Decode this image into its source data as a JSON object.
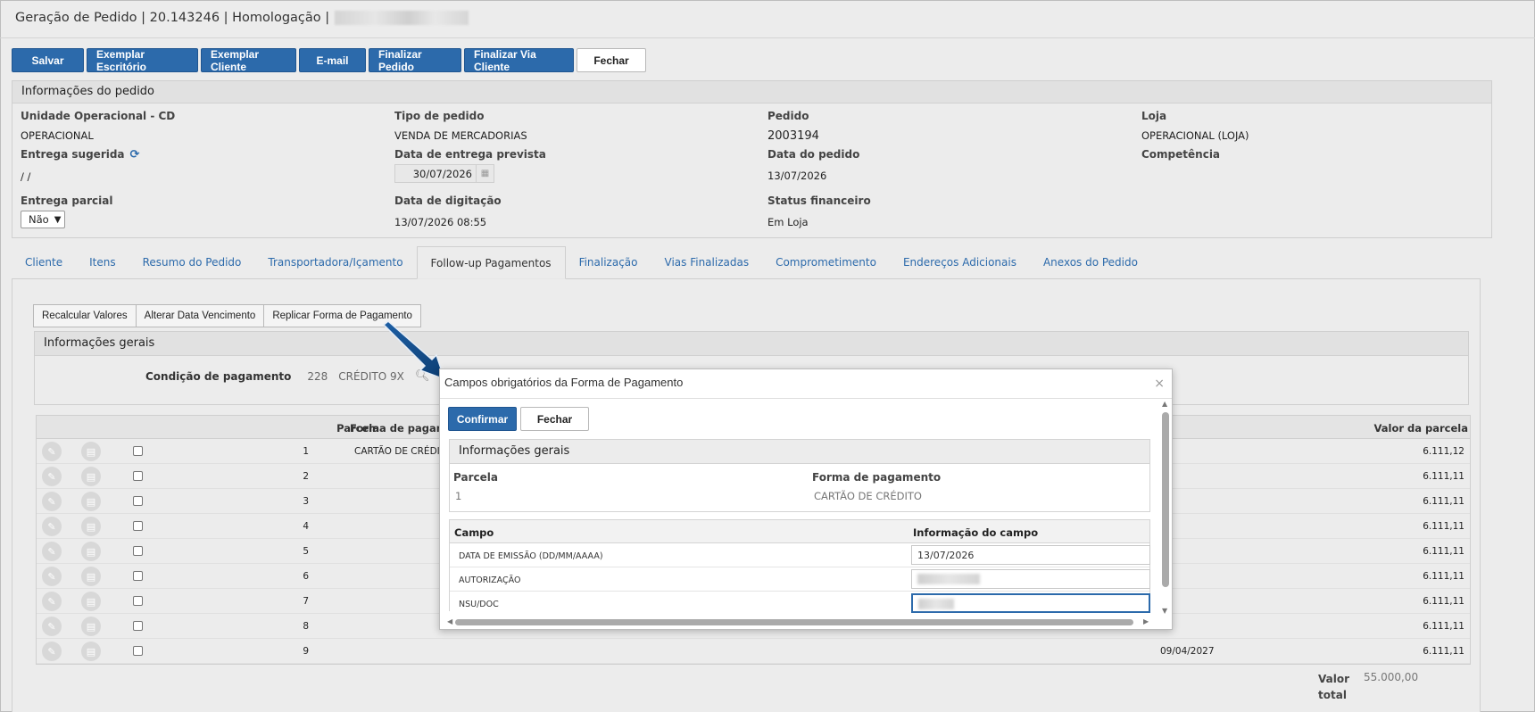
{
  "window": {
    "title": "Geração de Pedido | 20.143246 | Homologação |"
  },
  "toolbar": {
    "buttons": [
      "Salvar",
      "Exemplar Escritório",
      "Exemplar Cliente",
      "E-mail",
      "Finalizar Pedido",
      "Finalizar Via Cliente",
      "Fechar"
    ]
  },
  "order_info": {
    "heading": "Informações do pedido",
    "unidade_label": "Unidade Operacional - CD",
    "unidade_value": "OPERACIONAL",
    "tipo_label": "Tipo de pedido",
    "tipo_value": "VENDA DE MERCADORIAS",
    "pedido_label": "Pedido",
    "pedido_value": "2003194",
    "loja_label": "Loja",
    "loja_value": "OPERACIONAL (LOJA)",
    "entrega_sug_label": "Entrega sugerida",
    "entrega_sug_value": "/ /",
    "entrega_prev_label": "Data de entrega prevista",
    "entrega_prev_value": "30/07/2026",
    "data_pedido_label": "Data do pedido",
    "data_pedido_value": "13/07/2026",
    "competencia_label": "Competência",
    "entrega_parcial_label": "Entrega parcial",
    "entrega_parcial_value": "Não",
    "digitacao_label": "Data de digitação",
    "digitacao_value": "13/07/2026 08:55",
    "status_label": "Status financeiro",
    "status_value": "Em Loja"
  },
  "tabs": [
    "Cliente",
    "Itens",
    "Resumo do Pedido",
    "Transportadora/Içamento",
    "Follow-up Pagamentos",
    "Finalização",
    "Vias Finalizadas",
    "Comprometimento",
    "Endereços Adicionais",
    "Anexos do Pedido"
  ],
  "active_tab": "Follow-up Pagamentos",
  "sub_actions": [
    "Recalcular Valores",
    "Alterar Data Vencimento",
    "Replicar Forma de Pagamento"
  ],
  "general": {
    "heading": "Informações gerais",
    "condicao_label": "Condição de pagamento",
    "condicao_code": "228",
    "condicao_desc": "CRÉDITO 9X"
  },
  "installments": {
    "headers": {
      "parcela": "Parcela",
      "forma": "Forma de pagame",
      "valor": "Valor da parcela"
    },
    "rows": [
      {
        "n": "1",
        "forma": "CARTÃO DE CRÉDITO",
        "venc": "",
        "valor": "6.111,12"
      },
      {
        "n": "2",
        "forma": "",
        "venc": "",
        "valor": "6.111,11"
      },
      {
        "n": "3",
        "forma": "",
        "venc": "",
        "valor": "6.111,11"
      },
      {
        "n": "4",
        "forma": "",
        "venc": "",
        "valor": "6.111,11"
      },
      {
        "n": "5",
        "forma": "",
        "venc": "",
        "valor": "6.111,11"
      },
      {
        "n": "6",
        "forma": "",
        "venc": "",
        "valor": "6.111,11"
      },
      {
        "n": "7",
        "forma": "",
        "venc": "",
        "valor": "6.111,11"
      },
      {
        "n": "8",
        "forma": "",
        "venc": "",
        "valor": "6.111,11"
      },
      {
        "n": "9",
        "forma": "",
        "venc": "09/04/2027",
        "valor": "6.111,11"
      }
    ],
    "total_label": "Valor total",
    "total_value": "55.000,00"
  },
  "modal": {
    "title": "Campos obrigatórios da Forma de Pagamento",
    "confirm": "Confirmar",
    "close": "Fechar",
    "heading": "Informações gerais",
    "parcela_label": "Parcela",
    "parcela_value": "1",
    "forma_label": "Forma de pagamento",
    "forma_value": "CARTÃO DE CRÉDITO",
    "col_campo": "Campo",
    "col_info": "Informação do campo",
    "fields": [
      {
        "name": "DATA DE EMISSÃO (DD/MM/AAAA)",
        "value": "13/07/2026"
      },
      {
        "name": "AUTORIZAÇÃO",
        "value": ""
      },
      {
        "name": "NSU/DOC",
        "value": ""
      }
    ]
  }
}
